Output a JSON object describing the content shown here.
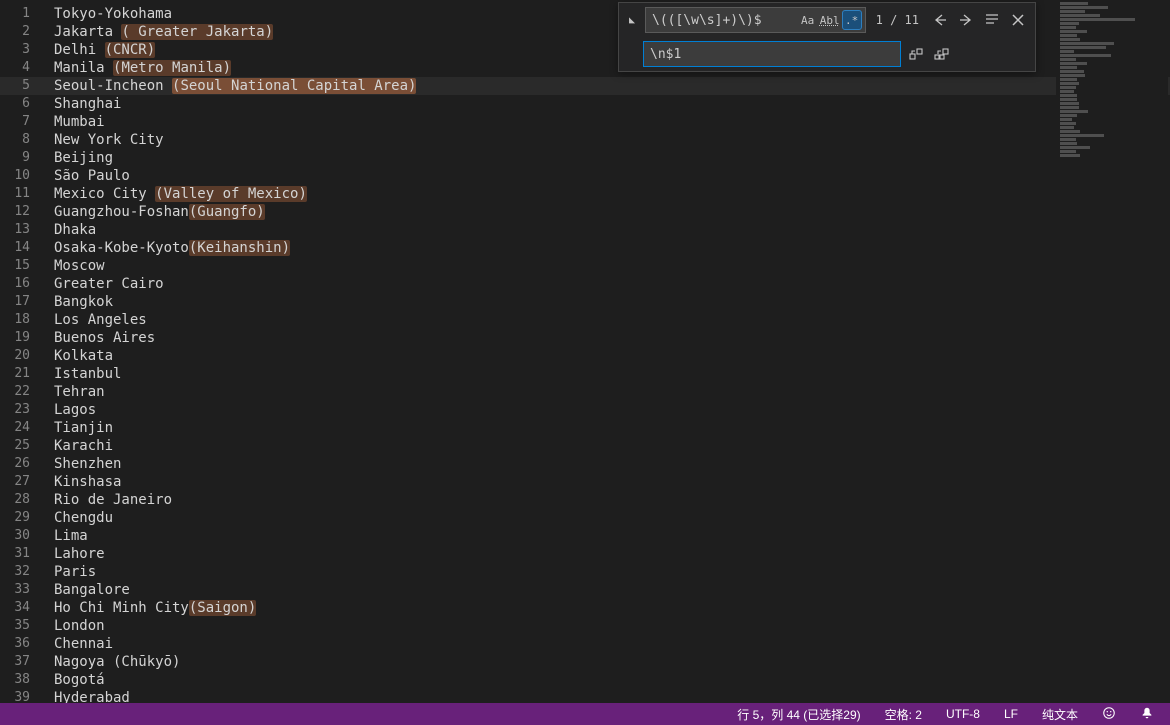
{
  "find": {
    "search_value": "\\(([\\w\\s]+)\\)$",
    "replace_value": "\\n$1",
    "match_count": "1 / 11",
    "case_sensitive": false,
    "whole_word": false,
    "regex": true
  },
  "current_line": 5,
  "lines": [
    {
      "n": 1,
      "pre": "Tokyo-Yokohama",
      "match": ""
    },
    {
      "n": 2,
      "pre": "Jakarta ",
      "match": "( Greater Jakarta)"
    },
    {
      "n": 3,
      "pre": "Delhi ",
      "match": "(CNCR)"
    },
    {
      "n": 4,
      "pre": "Manila ",
      "match": "(Metro Manila)"
    },
    {
      "n": 5,
      "pre": "Seoul-Incheon ",
      "match": "(Seoul National Capital Area)",
      "current_match": true
    },
    {
      "n": 6,
      "pre": "Shanghai",
      "match": ""
    },
    {
      "n": 7,
      "pre": "Mumbai",
      "match": ""
    },
    {
      "n": 8,
      "pre": "New York City",
      "match": ""
    },
    {
      "n": 9,
      "pre": "Beijing",
      "match": ""
    },
    {
      "n": 10,
      "pre": "São Paulo",
      "match": ""
    },
    {
      "n": 11,
      "pre": "Mexico City ",
      "match": "(Valley of Mexico)"
    },
    {
      "n": 12,
      "pre": "Guangzhou-Foshan",
      "match": "(Guangfo)"
    },
    {
      "n": 13,
      "pre": "Dhaka",
      "match": ""
    },
    {
      "n": 14,
      "pre": "Osaka-Kobe-Kyoto",
      "match": "(Keihanshin)"
    },
    {
      "n": 15,
      "pre": "Moscow",
      "match": ""
    },
    {
      "n": 16,
      "pre": "Greater Cairo",
      "match": ""
    },
    {
      "n": 17,
      "pre": "Bangkok",
      "match": ""
    },
    {
      "n": 18,
      "pre": "Los Angeles",
      "match": ""
    },
    {
      "n": 19,
      "pre": "Buenos Aires",
      "match": ""
    },
    {
      "n": 20,
      "pre": "Kolkata",
      "match": ""
    },
    {
      "n": 21,
      "pre": "Istanbul",
      "match": ""
    },
    {
      "n": 22,
      "pre": "Tehran",
      "match": ""
    },
    {
      "n": 23,
      "pre": "Lagos",
      "match": ""
    },
    {
      "n": 24,
      "pre": "Tianjin",
      "match": ""
    },
    {
      "n": 25,
      "pre": "Karachi",
      "match": ""
    },
    {
      "n": 26,
      "pre": "Shenzhen",
      "match": ""
    },
    {
      "n": 27,
      "pre": "Kinshasa",
      "match": ""
    },
    {
      "n": 28,
      "pre": "Rio de Janeiro",
      "match": ""
    },
    {
      "n": 29,
      "pre": "Chengdu",
      "match": ""
    },
    {
      "n": 30,
      "pre": "Lima",
      "match": ""
    },
    {
      "n": 31,
      "pre": "Lahore",
      "match": ""
    },
    {
      "n": 32,
      "pre": "Paris",
      "match": ""
    },
    {
      "n": 33,
      "pre": "Bangalore",
      "match": ""
    },
    {
      "n": 34,
      "pre": "Ho Chi Minh City",
      "match": "(Saigon)"
    },
    {
      "n": 35,
      "pre": "London",
      "match": ""
    },
    {
      "n": 36,
      "pre": "Chennai",
      "match": ""
    },
    {
      "n": 37,
      "pre": "Nagoya (Chūkyō)",
      "match": ""
    },
    {
      "n": 38,
      "pre": "Bogotá",
      "match": ""
    },
    {
      "n": 39,
      "pre": "Hyderabad",
      "match": ""
    }
  ],
  "status": {
    "cursor": "行 5，列 44 (已选择29)",
    "indent": "空格: 2",
    "encoding": "UTF-8",
    "eol": "LF",
    "language": "纯文本"
  }
}
